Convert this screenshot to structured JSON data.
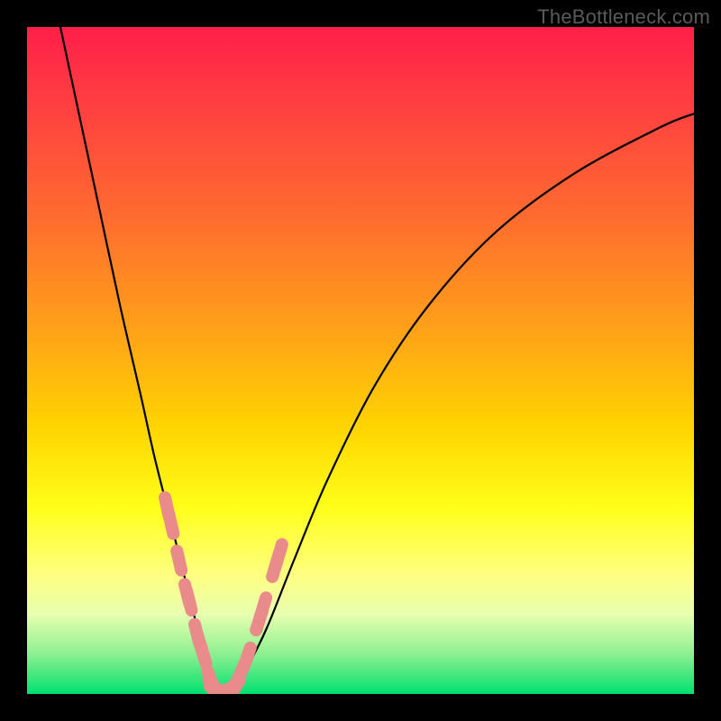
{
  "watermark": "TheBottleneck.com",
  "colors": {
    "frame": "#000000",
    "curve": "#000000",
    "marker_fill": "#e98b8b",
    "marker_stroke": "#d87878"
  },
  "chart_data": {
    "type": "line",
    "title": "",
    "xlabel": "",
    "ylabel": "",
    "xlim": [
      0,
      100
    ],
    "ylim": [
      0,
      100
    ],
    "grid": false,
    "legend": false,
    "series": [
      {
        "name": "bottleneck-curve",
        "x": [
          5,
          8,
          11,
          14,
          17,
          19,
          21,
          23,
          24.5,
          26,
          27,
          28,
          29.5,
          31,
          33,
          36,
          40,
          45,
          52,
          60,
          70,
          82,
          95,
          100
        ],
        "y": [
          100,
          86,
          72,
          58,
          45,
          36,
          28,
          20,
          14,
          8,
          4,
          1,
          0.5,
          1,
          4,
          10,
          20,
          32,
          46,
          58,
          69,
          78,
          85,
          87
        ]
      }
    ],
    "markers": {
      "name": "highlight-points",
      "x": [
        21.0,
        21.6,
        22.8,
        24.0,
        24.3,
        25.5,
        25.8,
        26.4,
        27.6,
        28.2,
        28.8,
        29.4,
        30.0,
        30.6,
        31.2,
        32.4,
        33.0,
        34.8,
        35.4,
        37.2,
        37.8
      ],
      "y": [
        28.0,
        25.5,
        20.0,
        15.0,
        14.0,
        9.0,
        8.0,
        6.0,
        2.0,
        1.0,
        0.6,
        0.5,
        0.6,
        1.0,
        1.5,
        4.0,
        5.5,
        11.0,
        13.0,
        19.0,
        21.0
      ]
    }
  }
}
